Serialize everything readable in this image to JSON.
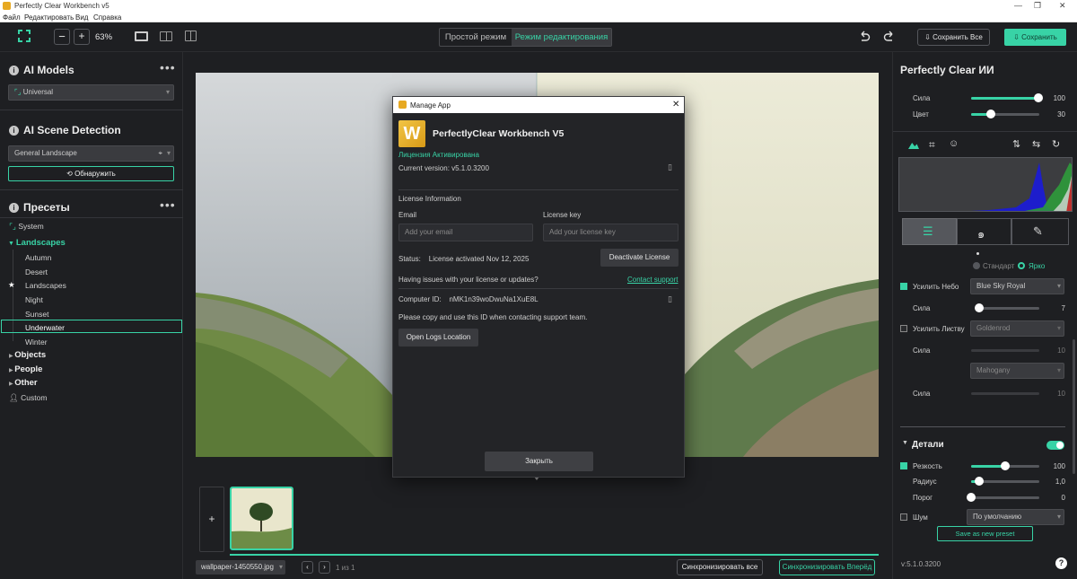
{
  "window": {
    "title": "Perfectly Clear Workbench v5",
    "controls": {
      "min": "—",
      "max": "❐",
      "close": "✕"
    }
  },
  "menu": {
    "items": [
      "Файл",
      "Редактировать",
      "Вид",
      "Справка"
    ]
  },
  "toolbar": {
    "zoom": "63%",
    "minus": "−",
    "plus": "+",
    "mode_simple": "Простой режим",
    "mode_edit": "Режим редактирования",
    "save_all": "Сохранить Все",
    "save": "Сохранить"
  },
  "left": {
    "ai_models": {
      "title": "AI Models",
      "value": "Universal"
    },
    "scene": {
      "title": "AI Scene Detection",
      "value": "General Landscape",
      "detect": "Обнаружить"
    },
    "presets": {
      "title": "Пресеты",
      "system": "System",
      "landscapes": "Landscapes",
      "items": [
        "Autumn",
        "Desert",
        "Landscapes",
        "Night",
        "Sunset",
        "Underwater",
        "Winter"
      ],
      "objects": "Objects",
      "people": "People",
      "other": "Other",
      "custom": "Custom"
    }
  },
  "right": {
    "title": "Perfectly Clear ИИ",
    "strength_label": "Сила",
    "strength_val": "100",
    "color_label": "Цвет",
    "color_val": "30",
    "mode_standard": "Стандарт",
    "mode_bright": "Ярко",
    "sky_label": "Усилить Небо",
    "sky_value": "Blue Sky Royal",
    "sky_strength_label": "Сила",
    "sky_strength_val": "7",
    "foliage_label": "Усилить Листву",
    "foliage_value": "Goldenrod",
    "foliage_strength_label": "Сила",
    "foliage_strength_val": "10",
    "mahogany_value": "Mahogany",
    "mahogany_strength_label": "Сила",
    "mahogany_strength_val": "10",
    "details_title": "Детали",
    "sharp_label": "Резкость",
    "sharp_val": "100",
    "radius_label": "Радиус",
    "radius_val": "1,0",
    "threshold_label": "Порог",
    "threshold_val": "0",
    "noise_label": "Шум",
    "noise_value": "По умолчанию",
    "save_preset": "Save as new preset",
    "version": "v:5.1.0.3200",
    "help": "?"
  },
  "bottom": {
    "file": "wallpaper-1450550.jpg",
    "pages": "1 из 1",
    "sync_all": "Синхронизировать все",
    "sync_forward": "Синхронизировать Вперёд",
    "add": "+"
  },
  "dialog": {
    "title": "Manage App",
    "app_name": "PerfectlyClear Workbench V5",
    "logo_letter": "W",
    "license_status": "Лицензия Активирована",
    "current_version": "Current version: v5.1.0.3200",
    "license_info": "License Information",
    "email_label": "Email",
    "email_placeholder": "Add your email",
    "key_label": "License key",
    "key_placeholder": "Add your license key",
    "status": "Status:    License activated Nov 12, 2025",
    "deactivate": "Deactivate License",
    "issues": "Having issues with your license or updates?",
    "support": "Contact support",
    "computer_id": "Computer ID:    nMK1n39woDwuNa1XuE8L",
    "copy_note": "Please copy and use this ID when contacting support team.",
    "open_logs": "Open Logs Location",
    "close": "Закрыть"
  },
  "colors": {
    "accent": "#38d3a6",
    "panel": "#1e1f22"
  }
}
